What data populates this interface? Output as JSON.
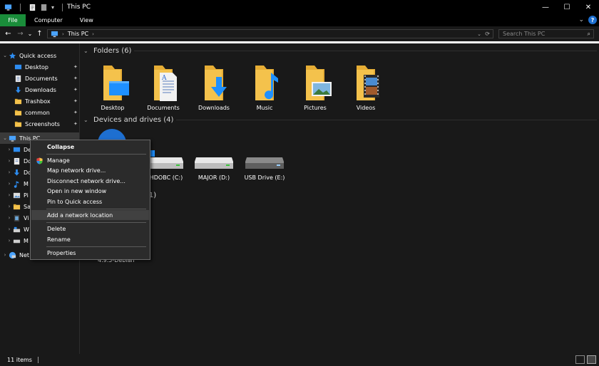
{
  "window": {
    "title": "This PC",
    "controls": {
      "minimize": "—",
      "maximize": "☐",
      "close": "✕"
    }
  },
  "ribbon": {
    "tabs": [
      "File",
      "Computer",
      "View"
    ],
    "expand_glyph": "⌄",
    "help_glyph": "?"
  },
  "address": {
    "back": "←",
    "forward": "→",
    "recent": "⌄",
    "up": "↑",
    "crumb": "This PC",
    "crumb_sep": "›",
    "dropdown": "⌄",
    "refresh": "⟳",
    "search_placeholder": "Search This PC",
    "search_icon": "⌕"
  },
  "nav": {
    "quick_access_label": "Quick access",
    "quick_items": [
      {
        "label": "Desktop",
        "icon": "desktop-icon",
        "pinned": true
      },
      {
        "label": "Documents",
        "icon": "documents-icon",
        "pinned": true
      },
      {
        "label": "Downloads",
        "icon": "downloads-icon",
        "pinned": true
      },
      {
        "label": "Trashbox",
        "icon": "folder-icon",
        "pinned": true
      },
      {
        "label": "common",
        "icon": "folder-icon",
        "pinned": true
      },
      {
        "label": "Screenshots",
        "icon": "folder-icon",
        "pinned": true
      }
    ],
    "this_pc_label": "This PC",
    "this_pc_children": [
      "De",
      "Do",
      "Do",
      "M",
      "Pi",
      "Sa",
      "Vi",
      "W",
      "M"
    ],
    "network_label": "Net",
    "pin_glyph": "📌"
  },
  "content": {
    "folders_header": "Folders (6)",
    "folders": [
      {
        "label": "Desktop",
        "overlay": "desktop"
      },
      {
        "label": "Documents",
        "overlay": "documents"
      },
      {
        "label": "Downloads",
        "overlay": "downloads"
      },
      {
        "label": "Music",
        "overlay": "music"
      },
      {
        "label": "Pictures",
        "overlay": "pictures"
      },
      {
        "label": "Videos",
        "overlay": "videos"
      }
    ],
    "devices_header": "Devices and drives (4)",
    "drives": [
      {
        "label": "NHDOBC (C:)",
        "icon": "windows-drive-icon"
      },
      {
        "label": "MAJOR (D:)",
        "icon": "hard-drive-icon"
      },
      {
        "label": "USB Drive (E:)",
        "icon": "usb-drive-icon"
      }
    ],
    "network_header_fragment": "(1)",
    "network_item_label": "4.9.5-Debian"
  },
  "context_menu": {
    "items": [
      {
        "label": "Collapse",
        "bold": true
      },
      {
        "label": "Manage",
        "icon": "shield-icon"
      },
      {
        "label": "Map network drive..."
      },
      {
        "label": "Disconnect network drive..."
      },
      {
        "label": "Open in new window"
      },
      {
        "label": "Pin to Quick access"
      },
      {
        "label": "Add a network location",
        "highlighted": true
      },
      {
        "label": "Delete"
      },
      {
        "label": "Rename"
      },
      {
        "label": "Properties"
      }
    ]
  },
  "status": {
    "item_count": "11 items"
  },
  "colors": {
    "accent_file_tab": "#1a8d3a",
    "folder_yellow": "#f4c24c",
    "windows_blue": "#1e90ff",
    "background": "#191919"
  }
}
